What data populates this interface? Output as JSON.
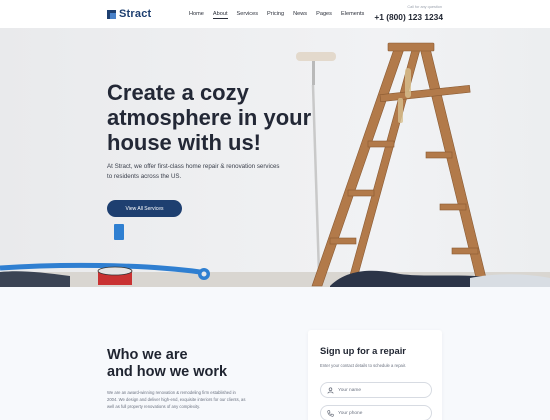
{
  "header": {
    "logo_text": "Stract",
    "nav": [
      "Home",
      "About",
      "Services",
      "Pricing",
      "News",
      "Pages",
      "Elements"
    ],
    "phone_label": "Call for any question",
    "phone": "+1 (800) 123 1234"
  },
  "hero": {
    "title": "Create a cozy atmosphere in your house with us!",
    "subtitle": "At Stract, we offer first-class home repair & renovation services to residents across the US.",
    "button": "View All Services"
  },
  "who": {
    "title_line1": "Who we are",
    "title_line2": "and how we work",
    "text": "We are an award-winning renovation & remodeling firm established in 2004. We design and deliver high-end, exquisite interiors for our clients, as well as full property renovations of any complexity."
  },
  "signup": {
    "title": "Sign up for a repair",
    "desc": "Enter your contact details to schedule a repair.",
    "fields": [
      {
        "placeholder": "Your name",
        "icon": "user-icon"
      },
      {
        "placeholder": "Your phone",
        "icon": "phone-icon"
      }
    ]
  },
  "colors": {
    "brand": "#1e3f70",
    "accent": "#4a82c9",
    "ladder": "#b27a4a",
    "tape": "#2f7fd1"
  }
}
